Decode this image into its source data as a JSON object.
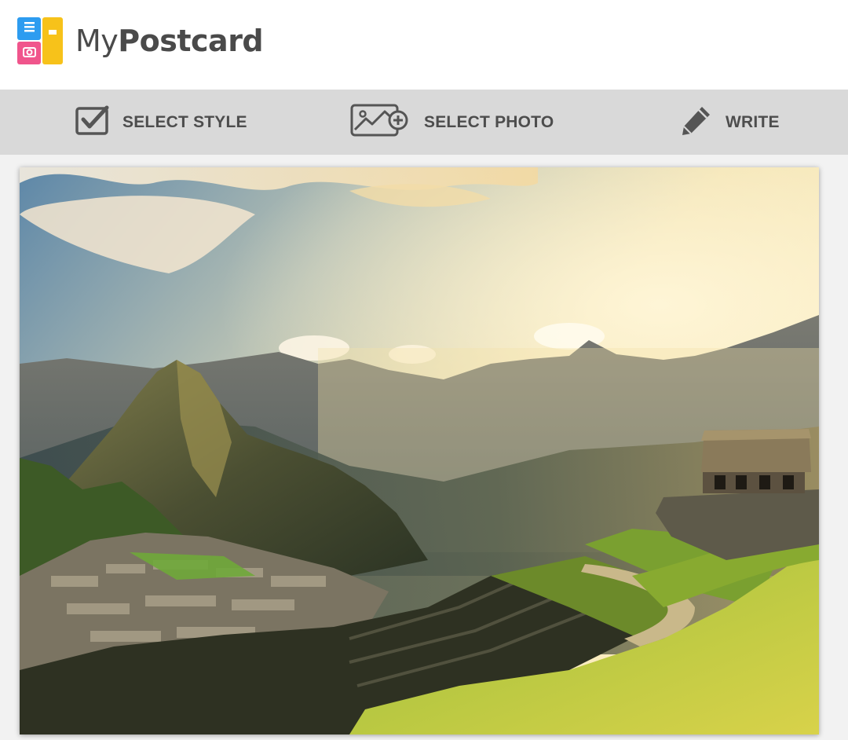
{
  "app": {
    "name_light": "My",
    "name_bold": "Postcard",
    "logo_icon": "postcard-logo-icon"
  },
  "steps": [
    {
      "label": "SELECT STYLE",
      "icon": "checkbox-icon"
    },
    {
      "label": "SELECT PHOTO",
      "icon": "add-photo-icon"
    },
    {
      "label": "WRITE",
      "icon": "pencil-icon"
    }
  ],
  "colors": {
    "header_bg": "#ffffff",
    "stepbar_bg": "#d9d9d9",
    "step_text": "#4d4d4d",
    "logo_blue": "#2d9cf0",
    "logo_pink": "#f0558c",
    "logo_yellow": "#f7c21a"
  },
  "photo": {
    "icon": "landscape-photo"
  }
}
